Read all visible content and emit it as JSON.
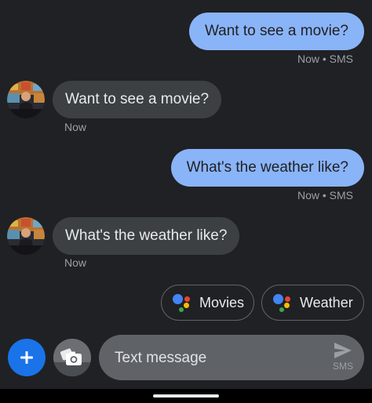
{
  "messages": [
    {
      "direction": "outgoing",
      "text": "Want to see a movie?",
      "meta": "Now • SMS"
    },
    {
      "direction": "incoming",
      "text": "Want to see a movie?",
      "meta": "Now"
    },
    {
      "direction": "outgoing",
      "text": "What's the weather like?",
      "meta": "Now • SMS"
    },
    {
      "direction": "incoming",
      "text": "What's the weather like?",
      "meta": "Now"
    }
  ],
  "suggestions": [
    {
      "label": "Movies",
      "icon": "google-assistant-icon"
    },
    {
      "label": "Weather",
      "icon": "google-assistant-icon"
    }
  ],
  "compose": {
    "placeholder": "Text message",
    "send_label": "SMS",
    "add_icon": "plus-icon",
    "gallery_icon": "camera-icon",
    "send_icon": "send-icon"
  },
  "colors": {
    "background": "#202124",
    "outgoing_bubble": "#8ab4f8",
    "incoming_bubble": "#3c4043",
    "fab": "#1a73e8",
    "assistant_blue": "#4285f4",
    "assistant_red": "#ea4335",
    "assistant_yellow": "#fbbc04",
    "assistant_green": "#34a853"
  }
}
